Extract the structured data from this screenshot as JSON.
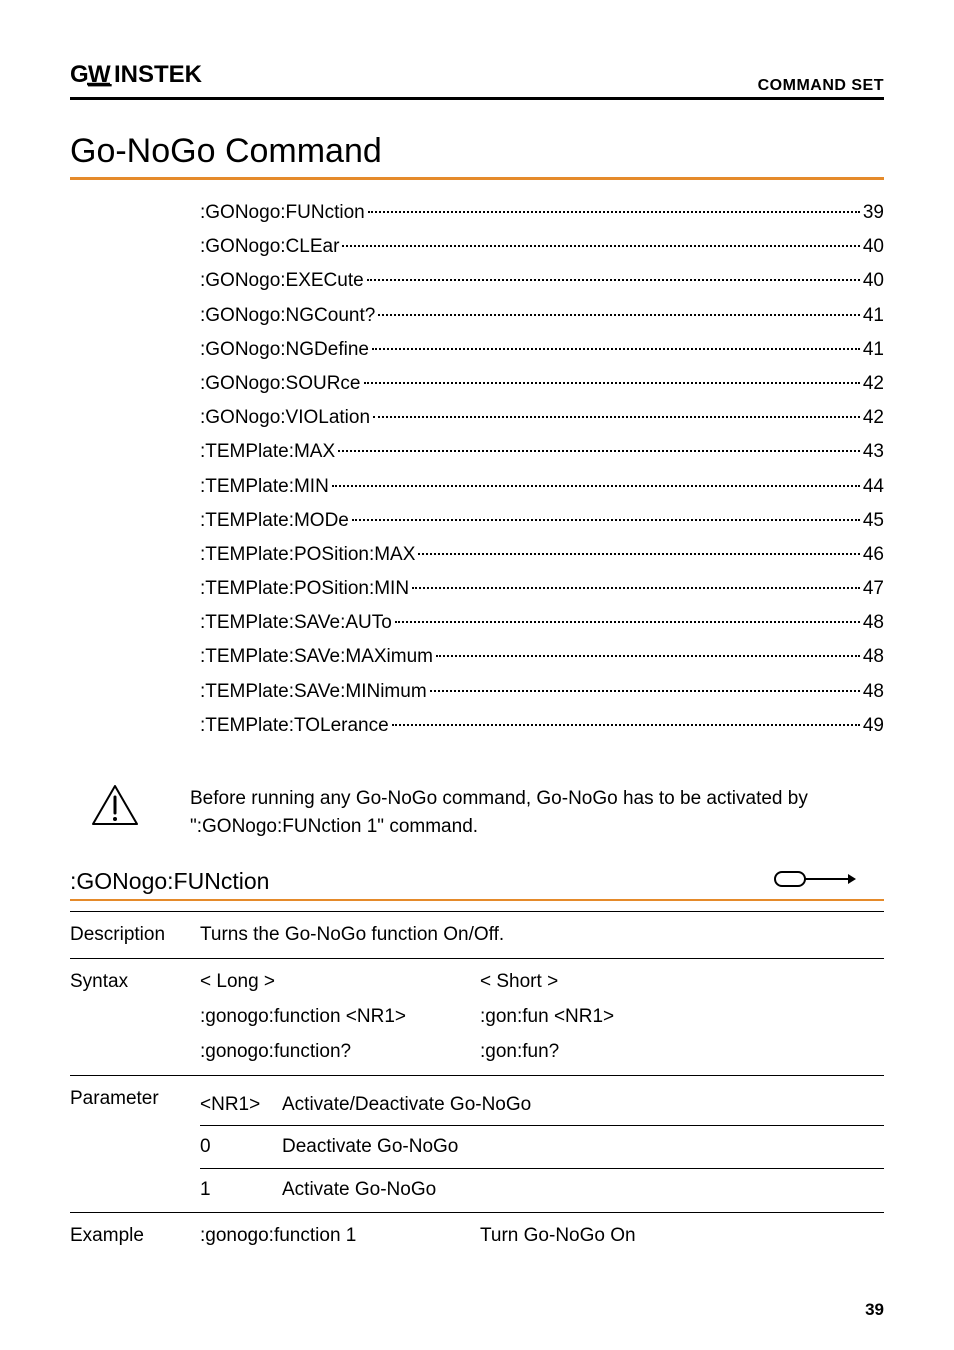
{
  "header": {
    "logo": "GW INSTEK",
    "section": "COMMAND SET"
  },
  "title": "Go-NoGo Command",
  "toc": [
    {
      "label": ":GONogo:FUNction",
      "page": "39"
    },
    {
      "label": ":GONogo:CLEar",
      "page": "40"
    },
    {
      "label": ":GONogo:EXECute",
      "page": "40"
    },
    {
      "label": ":GONogo:NGCount?",
      "page": "41"
    },
    {
      "label": ":GONogo:NGDefine",
      "page": "41"
    },
    {
      "label": ":GONogo:SOURce",
      "page": "42"
    },
    {
      "label": ":GONogo:VIOLation",
      "page": "42"
    },
    {
      "label": ":TEMPlate:MAX",
      "page": "43"
    },
    {
      "label": ":TEMPlate:MIN",
      "page": "44"
    },
    {
      "label": ":TEMPlate:MODe",
      "page": "45"
    },
    {
      "label": ":TEMPlate:POSition:MAX",
      "page": "46"
    },
    {
      "label": ":TEMPlate:POSition:MIN",
      "page": "47"
    },
    {
      "label": ":TEMPlate:SAVe:AUTo",
      "page": "48"
    },
    {
      "label": ":TEMPlate:SAVe:MAXimum",
      "page": "48"
    },
    {
      "label": ":TEMPlate:SAVe:MINimum",
      "page": "48"
    },
    {
      "label": ":TEMPlate:TOLerance",
      "page": "49"
    }
  ],
  "note": "Before running any Go-NoGo command, Go-NoGo has to be activated by \":GONogo:FUNction 1\" command.",
  "command": {
    "name": ":GONogo:FUNction",
    "description_label": "Description",
    "description_text": "Turns the Go-NoGo function On/Off.",
    "syntax_label": "Syntax",
    "syntax_long_hdr": "< Long >",
    "syntax_short_hdr": "< Short >",
    "syntax_long_1": ":gonogo:function <NR1>",
    "syntax_short_1": ":gon:fun <NR1>",
    "syntax_long_2": ":gonogo:function?",
    "syntax_short_2": ":gon:fun?",
    "parameter_label": "Parameter",
    "param_code_hdr": "<NR1>",
    "param_desc_hdr": "Activate/Deactivate Go-NoGo",
    "param_code_0": "0",
    "param_desc_0": "Deactivate Go-NoGo",
    "param_code_1": "1",
    "param_desc_1": "Activate Go-NoGo",
    "example_label": "Example",
    "example_cmd": ":gonogo:function 1",
    "example_desc": "Turn Go-NoGo On"
  },
  "page_number": "39"
}
